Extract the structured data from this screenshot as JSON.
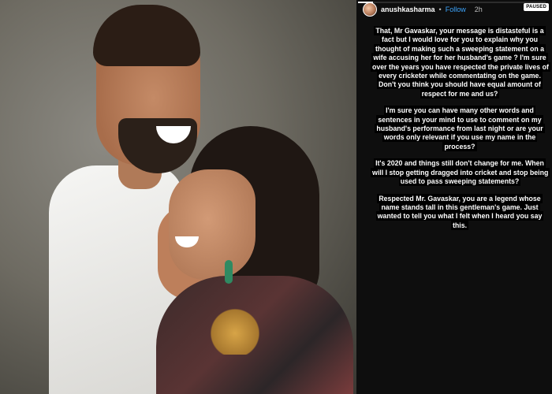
{
  "story": {
    "username": "anushkasharma",
    "dot": "•",
    "follow_label": "Follow",
    "time": "2h",
    "paused_label": "PAUSED",
    "progress": 0.08,
    "paragraphs": [
      "That, Mr Gavaskar, your message is distasteful is a fact but I would love for you to explain why you thought of making such a sweeping statement on a wife accusing her for her husband's game ? I'm sure over the years you have respected the private lives of every cricketer while commentating on the game. Don't you think you should have equal amount of respect for me and us?",
      "I'm sure you can have many other words and sentences in your mind to use to comment on my husband's performance from last night or are your words only relevant if you use my name in the process?",
      "It's 2020 and things still don't change for me. When will I stop getting dragged into cricket and stop being used to pass sweeping statements?",
      "Respected Mr. Gavaskar, you are a legend whose name stands tall in this gentleman's game. Just wanted to tell you what I felt when I heard you say this."
    ]
  },
  "colors": {
    "panel_bg": "#0e0e0e",
    "text": "#ffffff",
    "follow": "#3ea7ff",
    "text_highlight_bg": "#000000"
  },
  "icons": {
    "avatar": "user-avatar"
  }
}
